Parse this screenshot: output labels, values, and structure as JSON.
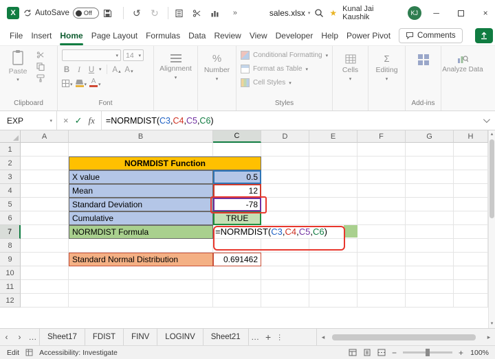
{
  "colors": {
    "excel_green": "#107C41",
    "annotation_red": "#E8362C",
    "title_fill": "#FFC000",
    "label_fill": "#B4C6E7",
    "formula_label_fill": "#A9D08E",
    "true_fill": "#C6E0B4",
    "result_fill": "#F4B084"
  },
  "titlebar": {
    "autosave_label": "AutoSave",
    "autosave_state": "Off",
    "filename": "sales.xlsx",
    "user_name": "Kunal Jai Kaushik",
    "user_initials": "KJ"
  },
  "menubar": {
    "tabs": [
      {
        "label": "File"
      },
      {
        "label": "Insert"
      },
      {
        "label": "Home"
      },
      {
        "label": "Page Layout"
      },
      {
        "label": "Formulas"
      },
      {
        "label": "Data"
      },
      {
        "label": "Review"
      },
      {
        "label": "View"
      },
      {
        "label": "Developer"
      },
      {
        "label": "Help"
      },
      {
        "label": "Power Pivot"
      }
    ],
    "active_tab": "Home",
    "comments_label": "Comments"
  },
  "ribbon": {
    "paste_label": "Paste",
    "font_size": "14",
    "groups": {
      "clipboard": "Clipboard",
      "font": "Font",
      "alignment": "Alignment",
      "number": "Number",
      "styles": "Styles",
      "addins": "Add-ins"
    },
    "styles_items": [
      "Conditional Formatting",
      "Format as Table",
      "Cell Styles"
    ],
    "cells_label": "Cells",
    "editing_label": "Editing",
    "analyze_label": "Analyze Data"
  },
  "formula_bar": {
    "name_box": "EXP",
    "fx_label": "fx",
    "formula_plain": "=NORMDIST(C3,C4,C5,C6)",
    "formula_tokens": [
      {
        "text": "=NORMDIST(",
        "color": "#000000"
      },
      {
        "text": "C3",
        "color": "#1F62C5"
      },
      {
        "text": ",",
        "color": "#000000"
      },
      {
        "text": "C4",
        "color": "#CF2E1F"
      },
      {
        "text": ",",
        "color": "#000000"
      },
      {
        "text": "C5",
        "color": "#7030A0"
      },
      {
        "text": ",",
        "color": "#000000"
      },
      {
        "text": "C6",
        "color": "#107C41"
      },
      {
        "text": ")",
        "color": "#000000"
      }
    ]
  },
  "grid": {
    "column_headers": [
      "A",
      "B",
      "C",
      "D",
      "E",
      "F",
      "G",
      "H"
    ],
    "row_headers": [
      "1",
      "2",
      "3",
      "4",
      "5",
      "6",
      "7",
      "8",
      "9",
      "10",
      "11",
      "12"
    ],
    "active_column": "C",
    "active_row": "7",
    "table": {
      "title": "NORMDIST Function",
      "rows": [
        {
          "label": "X value",
          "value": "0.5"
        },
        {
          "label": "Mean",
          "value": "12"
        },
        {
          "label": "Standard Deviation",
          "value": "-78"
        },
        {
          "label": "Cumulative",
          "value": "TRUE"
        },
        {
          "label": "NORMDIST Formula",
          "value": "=NORMDIST(C3,C4,C5,C6)"
        }
      ],
      "result_label": "Standard Normal Distribution",
      "result_value": "0.691462"
    }
  },
  "sheet_bar": {
    "tabs": [
      "Sheet17",
      "FDIST",
      "FINV",
      "LOGINV",
      "Sheet21"
    ]
  },
  "status_bar": {
    "mode": "Edit",
    "accessibility": "Accessibility: Investigate",
    "zoom": "100%"
  }
}
